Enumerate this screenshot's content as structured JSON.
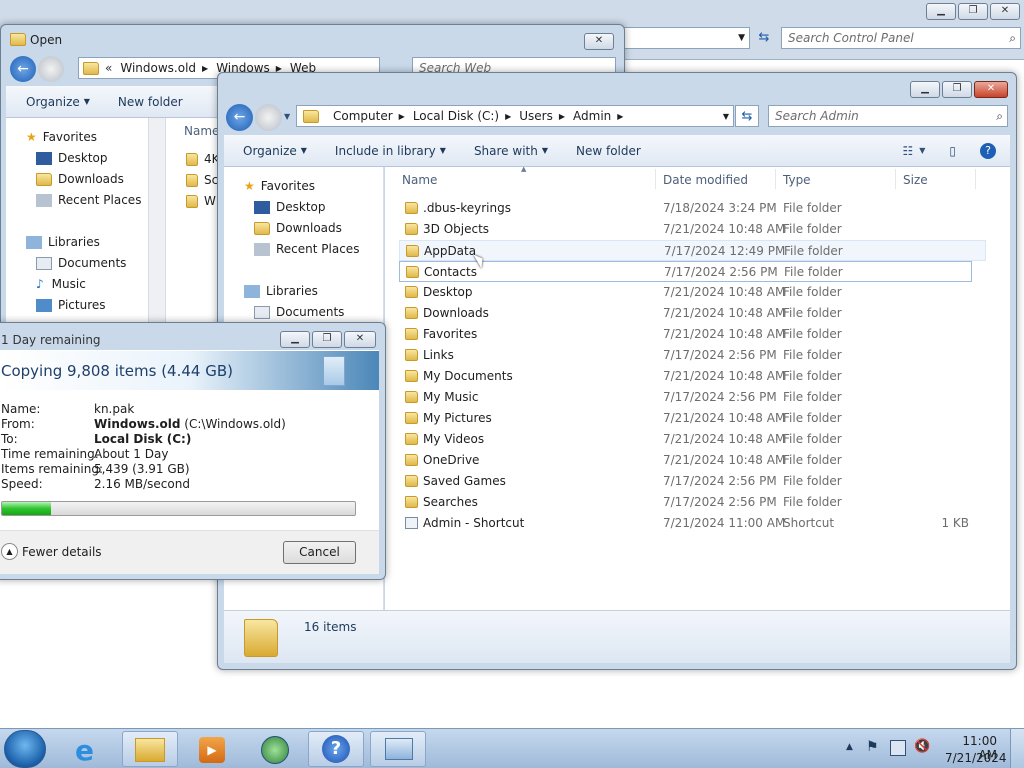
{
  "background_window": {
    "search_placeholder": "Search Control Panel"
  },
  "open_dialog": {
    "title": "Open",
    "address": [
      "«",
      "Windows.old",
      "Windows",
      "Web"
    ],
    "search_placeholder": "Search Web",
    "toolbar": {
      "organize": "Organize",
      "new_folder": "New folder"
    },
    "nav": {
      "favorites": "Favorites",
      "desktop": "Desktop",
      "downloads": "Downloads",
      "recent": "Recent Places",
      "libraries": "Libraries",
      "documents": "Documents",
      "music": "Music",
      "pictures": "Pictures"
    },
    "column_name": "Name",
    "files": [
      "4K",
      "Sc",
      "W"
    ]
  },
  "explorer": {
    "address": [
      "Computer",
      "Local Disk (C:)",
      "Users",
      "Admin"
    ],
    "search_placeholder": "Search Admin",
    "toolbar": {
      "organize": "Organize",
      "include_in_library": "Include in library",
      "share_with": "Share with",
      "new_folder": "New folder"
    },
    "nav": {
      "favorites": "Favorites",
      "desktop": "Desktop",
      "downloads": "Downloads",
      "recent": "Recent Places",
      "libraries": "Libraries",
      "documents": "Documents"
    },
    "columns": {
      "name": "Name",
      "date": "Date modified",
      "type": "Type",
      "size": "Size"
    },
    "rows": [
      {
        "name": ".dbus-keyrings",
        "date": "7/18/2024 3:24 PM",
        "type": "File folder",
        "size": ""
      },
      {
        "name": "3D Objects",
        "date": "7/21/2024 10:48 AM",
        "type": "File folder",
        "size": ""
      },
      {
        "name": "AppData",
        "date": "7/17/2024 12:49 PM",
        "type": "File folder",
        "size": ""
      },
      {
        "name": "Contacts",
        "date": "7/17/2024 2:56 PM",
        "type": "File folder",
        "size": ""
      },
      {
        "name": "Desktop",
        "date": "7/21/2024 10:48 AM",
        "type": "File folder",
        "size": ""
      },
      {
        "name": "Downloads",
        "date": "7/21/2024 10:48 AM",
        "type": "File folder",
        "size": ""
      },
      {
        "name": "Favorites",
        "date": "7/21/2024 10:48 AM",
        "type": "File folder",
        "size": ""
      },
      {
        "name": "Links",
        "date": "7/17/2024 2:56 PM",
        "type": "File folder",
        "size": ""
      },
      {
        "name": "My Documents",
        "date": "7/21/2024 10:48 AM",
        "type": "File folder",
        "size": ""
      },
      {
        "name": "My Music",
        "date": "7/17/2024 2:56 PM",
        "type": "File folder",
        "size": ""
      },
      {
        "name": "My Pictures",
        "date": "7/21/2024 10:48 AM",
        "type": "File folder",
        "size": ""
      },
      {
        "name": "My Videos",
        "date": "7/21/2024 10:48 AM",
        "type": "File folder",
        "size": ""
      },
      {
        "name": "OneDrive",
        "date": "7/21/2024 10:48 AM",
        "type": "File folder",
        "size": ""
      },
      {
        "name": "Saved Games",
        "date": "7/17/2024 2:56 PM",
        "type": "File folder",
        "size": ""
      },
      {
        "name": "Searches",
        "date": "7/17/2024 2:56 PM",
        "type": "File folder",
        "size": ""
      },
      {
        "name": "Admin - Shortcut",
        "date": "7/21/2024 11:00 AM",
        "type": "Shortcut",
        "size": "1 KB"
      }
    ],
    "status": "16 items"
  },
  "copy_dialog": {
    "title": "1 Day remaining",
    "heading": "Copying 9,808 items (4.44 GB)",
    "labels": {
      "name": "Name:",
      "from": "From:",
      "to": "To:",
      "time": "Time remaining:",
      "items": "Items remaining:",
      "speed": "Speed:"
    },
    "values": {
      "name": "kn.pak",
      "from_bold": "Windows.old",
      "from_rest": "(C:\\Windows.old)",
      "to": "Local Disk (C:)",
      "time": "About 1 Day",
      "items": "5,439 (3.91 GB)",
      "speed": "2.16 MB/second"
    },
    "progress_percent": 14,
    "fewer_details": "Fewer details",
    "cancel": "Cancel"
  },
  "taskbar": {
    "time": "11:00 AM",
    "date": "7/21/2024"
  }
}
